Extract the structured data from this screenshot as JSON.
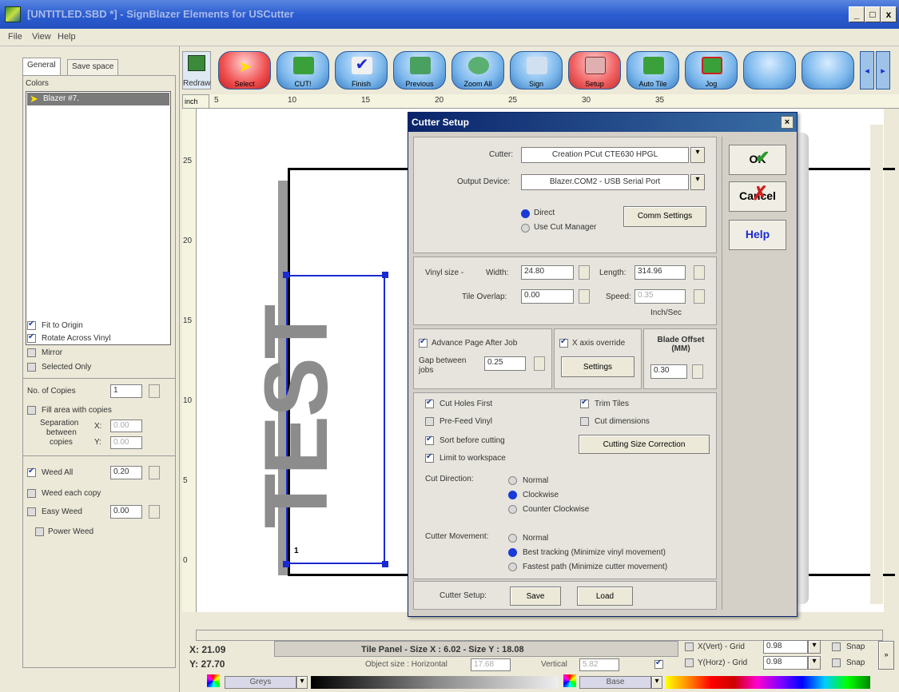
{
  "window": {
    "title": "[UNTITLED.SBD *] - SignBlazer Elements for USCutter",
    "minimize": "_",
    "maximize": "□",
    "close": "x"
  },
  "menu": [
    "File",
    "View",
    "Help"
  ],
  "left": {
    "tabs": [
      "General",
      "Save space"
    ],
    "colors_label": "Colors",
    "color_item": "Blazer #7.",
    "checks": [
      {
        "label": "Fit to Origin",
        "checked": true
      },
      {
        "label": "Rotate Across Vinyl",
        "checked": true
      },
      {
        "label": "Mirror",
        "checked": false
      },
      {
        "label": "Selected Only",
        "checked": false
      }
    ],
    "copies_label": "No. of Copies",
    "copies_value": "1",
    "fill_area": "Fill area with copies",
    "separation_label": "Separation",
    "between_label": "between",
    "copies_label2": "copies",
    "x_label": "X:",
    "y_label": "Y:",
    "sep_x": "0.00",
    "sep_y": "0.00",
    "weed_all": "Weed All",
    "weed_all_value": "0.20",
    "weed_each": "Weed each copy",
    "easy_weed": "Easy Weed",
    "easy_weed_value": "0.00",
    "power_weed": "Power Weed"
  },
  "toolbar": [
    "Redraw",
    "Select",
    "CUT!",
    "Finish",
    "Previous",
    "Zoom All",
    "Sign",
    "Setup",
    "Auto Tile",
    "Jog"
  ],
  "ruler": {
    "unit": "inch",
    "h_ticks": [
      "5",
      "10",
      "15",
      "20",
      "25",
      "30",
      "35"
    ],
    "v_ticks": [
      "25",
      "20",
      "15",
      "10",
      "5",
      "0"
    ]
  },
  "canvas": {
    "text": "TEST",
    "object_index": "1"
  },
  "dialog": {
    "title": "Cutter Setup",
    "close": "×",
    "cutter_label": "Cutter:",
    "cutter_value": "Creation PCut CTE630 HPGL",
    "output_label": "Output Device:",
    "output_value": "Blazer.COM2 - USB Serial Port",
    "direct": "Direct",
    "use_cut_manager": "Use Cut Manager",
    "comm_settings": "Comm Settings",
    "vinyl_size": "Vinyl size -",
    "width_label": "Width:",
    "width_value": "24.80",
    "length_label": "Length:",
    "length_value": "314.96",
    "tile_overlap_label": "Tile Overlap:",
    "tile_overlap_value": "0.00",
    "speed_label": "Speed:",
    "speed_value": "0.35",
    "speed_unit": "Inch/Sec",
    "advance_page": "Advance Page After Job",
    "gap_label": "Gap between jobs",
    "gap_value": "0.25",
    "x_axis_override": "X axis override",
    "settings": "Settings",
    "blade_offset": "Blade Offset (MM)",
    "blade_value": "0.30",
    "cut_holes_first": "Cut Holes First",
    "trim_tiles": "Trim Tiles",
    "pre_feed": "Pre-Feed Vinyl",
    "cut_dimensions": "Cut dimensions",
    "sort_before": "Sort before cutting",
    "cutting_size": "Cutting Size Correction",
    "limit_workspace": "Limit to workspace",
    "cut_direction": "Cut Direction:",
    "dir_normal": "Normal",
    "dir_clockwise": "Clockwise",
    "dir_counter": "Counter Clockwise",
    "cutter_movement": "Cutter Movement:",
    "mov_normal": "Normal",
    "mov_best": "Best tracking (Minimize vinyl movement)",
    "mov_fastest": "Fastest path (Minimize cutter movement)",
    "cutter_setup_label": "Cutter Setup:",
    "save": "Save",
    "load": "Load",
    "ok": "OK",
    "cancel": "Cancel",
    "help": "Help"
  },
  "status": {
    "x": "X: 21.09",
    "y": "Y: 27.70",
    "tile_panel": "Tile Panel - Size X : 6.02 - Size Y : 18.08",
    "object_size": "Object size : Horizontal",
    "horizontal_value": "17.68",
    "vertical_label": "Vertical",
    "vertical_value": "5.82",
    "xvert_grid": "X(Vert) - Grid",
    "yhorz_grid": "Y(Horz) - Grid",
    "grid_x": "0.98",
    "grid_y": "0.98",
    "snap1": "Snap",
    "snap2": "Snap",
    "greys": "Greys",
    "base": "Base"
  },
  "colors": {
    "title_bar": "#2c5dd0",
    "dialog_title": "#0a246a",
    "object_text": "#8c8c8c",
    "selection": "#1a2ad0"
  }
}
